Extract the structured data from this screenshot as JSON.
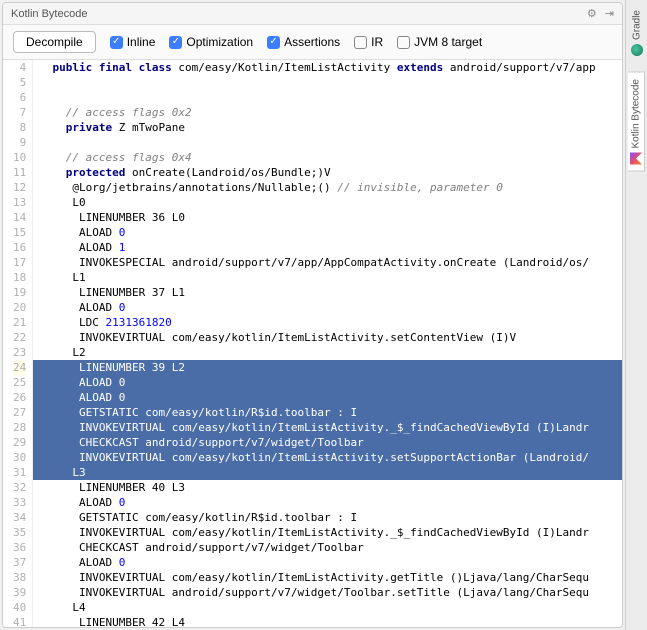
{
  "title": "Kotlin Bytecode",
  "toolbar": {
    "decompile_label": "Decompile",
    "checks": [
      {
        "label": "Inline",
        "checked": true
      },
      {
        "label": "Optimization",
        "checked": true
      },
      {
        "label": "Assertions",
        "checked": true
      },
      {
        "label": "IR",
        "checked": false
      },
      {
        "label": "JVM 8 target",
        "checked": false
      }
    ]
  },
  "side_tabs": [
    {
      "label": "Gradle",
      "icon": "gradle"
    },
    {
      "label": "Kotlin Bytecode",
      "icon": "kotlin",
      "active": true
    }
  ],
  "code": {
    "first_line": 4,
    "highlight_start": 24,
    "highlight_end": 31,
    "current_line": 24,
    "lines": [
      {
        "n": 4,
        "indent": 2,
        "tokens": [
          [
            "kw",
            "public final class"
          ],
          [
            "",
            " com/easy/Kotlin/ItemListActivity "
          ],
          [
            "kw",
            "extends"
          ],
          [
            "",
            " android/support/v7/app"
          ]
        ]
      },
      {
        "n": 5,
        "indent": 0,
        "tokens": []
      },
      {
        "n": 6,
        "indent": 0,
        "tokens": []
      },
      {
        "n": 7,
        "indent": 4,
        "tokens": [
          [
            "cm",
            "// access flags 0x2"
          ]
        ]
      },
      {
        "n": 8,
        "indent": 4,
        "tokens": [
          [
            "kw",
            "private"
          ],
          [
            "",
            " Z mTwoPane"
          ]
        ]
      },
      {
        "n": 9,
        "indent": 0,
        "tokens": []
      },
      {
        "n": 10,
        "indent": 4,
        "tokens": [
          [
            "cm",
            "// access flags 0x4"
          ]
        ]
      },
      {
        "n": 11,
        "indent": 4,
        "tokens": [
          [
            "kw",
            "protected"
          ],
          [
            "",
            " onCreate(Landroid/os/Bundle;)V"
          ]
        ]
      },
      {
        "n": 12,
        "indent": 5,
        "tokens": [
          [
            "",
            "@Lorg/jetbrains/annotations/Nullable;() "
          ],
          [
            "cm",
            "// invisible, parameter 0"
          ]
        ]
      },
      {
        "n": 13,
        "indent": 5,
        "tokens": [
          [
            "",
            "L0"
          ]
        ]
      },
      {
        "n": 14,
        "indent": 6,
        "tokens": [
          [
            "",
            "LINENUMBER 36 L0"
          ]
        ]
      },
      {
        "n": 15,
        "indent": 6,
        "tokens": [
          [
            "",
            "ALOAD "
          ],
          [
            "num",
            "0"
          ]
        ]
      },
      {
        "n": 16,
        "indent": 6,
        "tokens": [
          [
            "",
            "ALOAD "
          ],
          [
            "num",
            "1"
          ]
        ]
      },
      {
        "n": 17,
        "indent": 6,
        "tokens": [
          [
            "",
            "INVOKESPECIAL android/support/v7/app/AppCompatActivity.onCreate (Landroid/os/"
          ]
        ]
      },
      {
        "n": 18,
        "indent": 5,
        "tokens": [
          [
            "",
            "L1"
          ]
        ]
      },
      {
        "n": 19,
        "indent": 6,
        "tokens": [
          [
            "",
            "LINENUMBER 37 L1"
          ]
        ]
      },
      {
        "n": 20,
        "indent": 6,
        "tokens": [
          [
            "",
            "ALOAD "
          ],
          [
            "num",
            "0"
          ]
        ]
      },
      {
        "n": 21,
        "indent": 6,
        "tokens": [
          [
            "",
            "LDC "
          ],
          [
            "num",
            "2131361820"
          ]
        ]
      },
      {
        "n": 22,
        "indent": 6,
        "tokens": [
          [
            "",
            "INVOKEVIRTUAL com/easy/kotlin/ItemListActivity.setContentView (I)V"
          ]
        ]
      },
      {
        "n": 23,
        "indent": 5,
        "tokens": [
          [
            "",
            "L2"
          ]
        ]
      },
      {
        "n": 24,
        "indent": 6,
        "tokens": [
          [
            "",
            "LINENUMBER 39 L2"
          ]
        ]
      },
      {
        "n": 25,
        "indent": 6,
        "tokens": [
          [
            "",
            "ALOAD 0"
          ]
        ]
      },
      {
        "n": 26,
        "indent": 6,
        "tokens": [
          [
            "",
            "ALOAD 0"
          ]
        ]
      },
      {
        "n": 27,
        "indent": 6,
        "tokens": [
          [
            "",
            "GETSTATIC com/easy/kotlin/R$id.toolbar : I"
          ]
        ]
      },
      {
        "n": 28,
        "indent": 6,
        "tokens": [
          [
            "",
            "INVOKEVIRTUAL com/easy/kotlin/ItemListActivity._$_findCachedViewById (I)Landr"
          ]
        ]
      },
      {
        "n": 29,
        "indent": 6,
        "tokens": [
          [
            "",
            "CHECKCAST android/support/v7/widget/Toolbar"
          ]
        ]
      },
      {
        "n": 30,
        "indent": 6,
        "tokens": [
          [
            "",
            "INVOKEVIRTUAL com/easy/kotlin/ItemListActivity.setSupportActionBar (Landroid/"
          ]
        ]
      },
      {
        "n": 31,
        "indent": 5,
        "tokens": [
          [
            "",
            "L3"
          ]
        ]
      },
      {
        "n": 32,
        "indent": 6,
        "tokens": [
          [
            "",
            "LINENUMBER 40 L3"
          ]
        ]
      },
      {
        "n": 33,
        "indent": 6,
        "tokens": [
          [
            "",
            "ALOAD "
          ],
          [
            "num",
            "0"
          ]
        ]
      },
      {
        "n": 34,
        "indent": 6,
        "tokens": [
          [
            "",
            "GETSTATIC com/easy/kotlin/R$id.toolbar : I"
          ]
        ]
      },
      {
        "n": 35,
        "indent": 6,
        "tokens": [
          [
            "",
            "INVOKEVIRTUAL com/easy/kotlin/ItemListActivity._$_findCachedViewById (I)Landr"
          ]
        ]
      },
      {
        "n": 36,
        "indent": 6,
        "tokens": [
          [
            "",
            "CHECKCAST android/support/v7/widget/Toolbar"
          ]
        ]
      },
      {
        "n": 37,
        "indent": 6,
        "tokens": [
          [
            "",
            "ALOAD "
          ],
          [
            "num",
            "0"
          ]
        ]
      },
      {
        "n": 38,
        "indent": 6,
        "tokens": [
          [
            "",
            "INVOKEVIRTUAL com/easy/kotlin/ItemListActivity.getTitle ()Ljava/lang/CharSequ"
          ]
        ]
      },
      {
        "n": 39,
        "indent": 6,
        "tokens": [
          [
            "",
            "INVOKEVIRTUAL android/support/v7/widget/Toolbar.setTitle (Ljava/lang/CharSequ"
          ]
        ]
      },
      {
        "n": 40,
        "indent": 5,
        "tokens": [
          [
            "",
            "L4"
          ]
        ]
      },
      {
        "n": 41,
        "indent": 6,
        "tokens": [
          [
            "",
            "LINENUMBER 42 L4"
          ]
        ]
      }
    ]
  }
}
